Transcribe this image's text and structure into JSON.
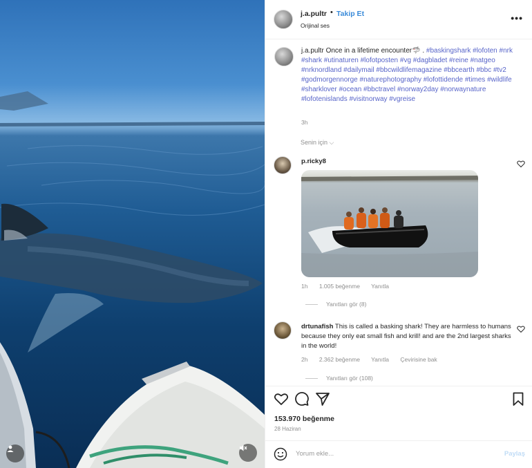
{
  "post": {
    "username": "j.a.pultr",
    "dot": "•",
    "follow_label": "Takip Et",
    "audio": "Orijinal ses",
    "more": "•••",
    "caption_user": "j.a.pultr",
    "caption_text": "Once in a lifetime encounter🦈 .",
    "caption_tags": "#baskingshark #lofoten #nrk #shark #utinaturen #lofotposten #vg #dagbladet #reine #natgeo #nrknordland #dailymail #bbcwildlifemagazine #bbcearth #bbc #tv2 #godmorgennorge #naturephotography #lofottidende #times #wildlife #sharklover #ocean #bbctravel #norway2day #norwaynature #lofotenislands #visitnorway #vgreise",
    "caption_time": "3h",
    "for_you": "Senin için ⌵"
  },
  "comments": [
    {
      "username": "p.ricky8",
      "time": "1h",
      "likes": "1.005 beğenme",
      "reply": "Yanıtla",
      "view_replies": "Yanıtları gör (8)"
    },
    {
      "username": "drtunafish",
      "text": "This is called a basking shark! They are harmless to humans because they only eat small fish and krill! and are the 2nd largest sharks in the world!",
      "time": "2h",
      "likes": "2.362 beğenme",
      "reply": "Yanıtla",
      "translate": "Çevirisine bak",
      "view_replies": "Yanıtları gör (108)"
    }
  ],
  "footer": {
    "likes": "153.970 beğenme",
    "date": "28 Haziran",
    "comment_placeholder": "Yorum ekle...",
    "post_label": "Paylaş"
  },
  "icons": {
    "like": "heart-icon",
    "comment": "comment-icon",
    "share": "share-icon",
    "save": "bookmark-icon",
    "emoji": "emoji-icon",
    "user": "user-tag-icon",
    "mute": "mute-icon"
  }
}
